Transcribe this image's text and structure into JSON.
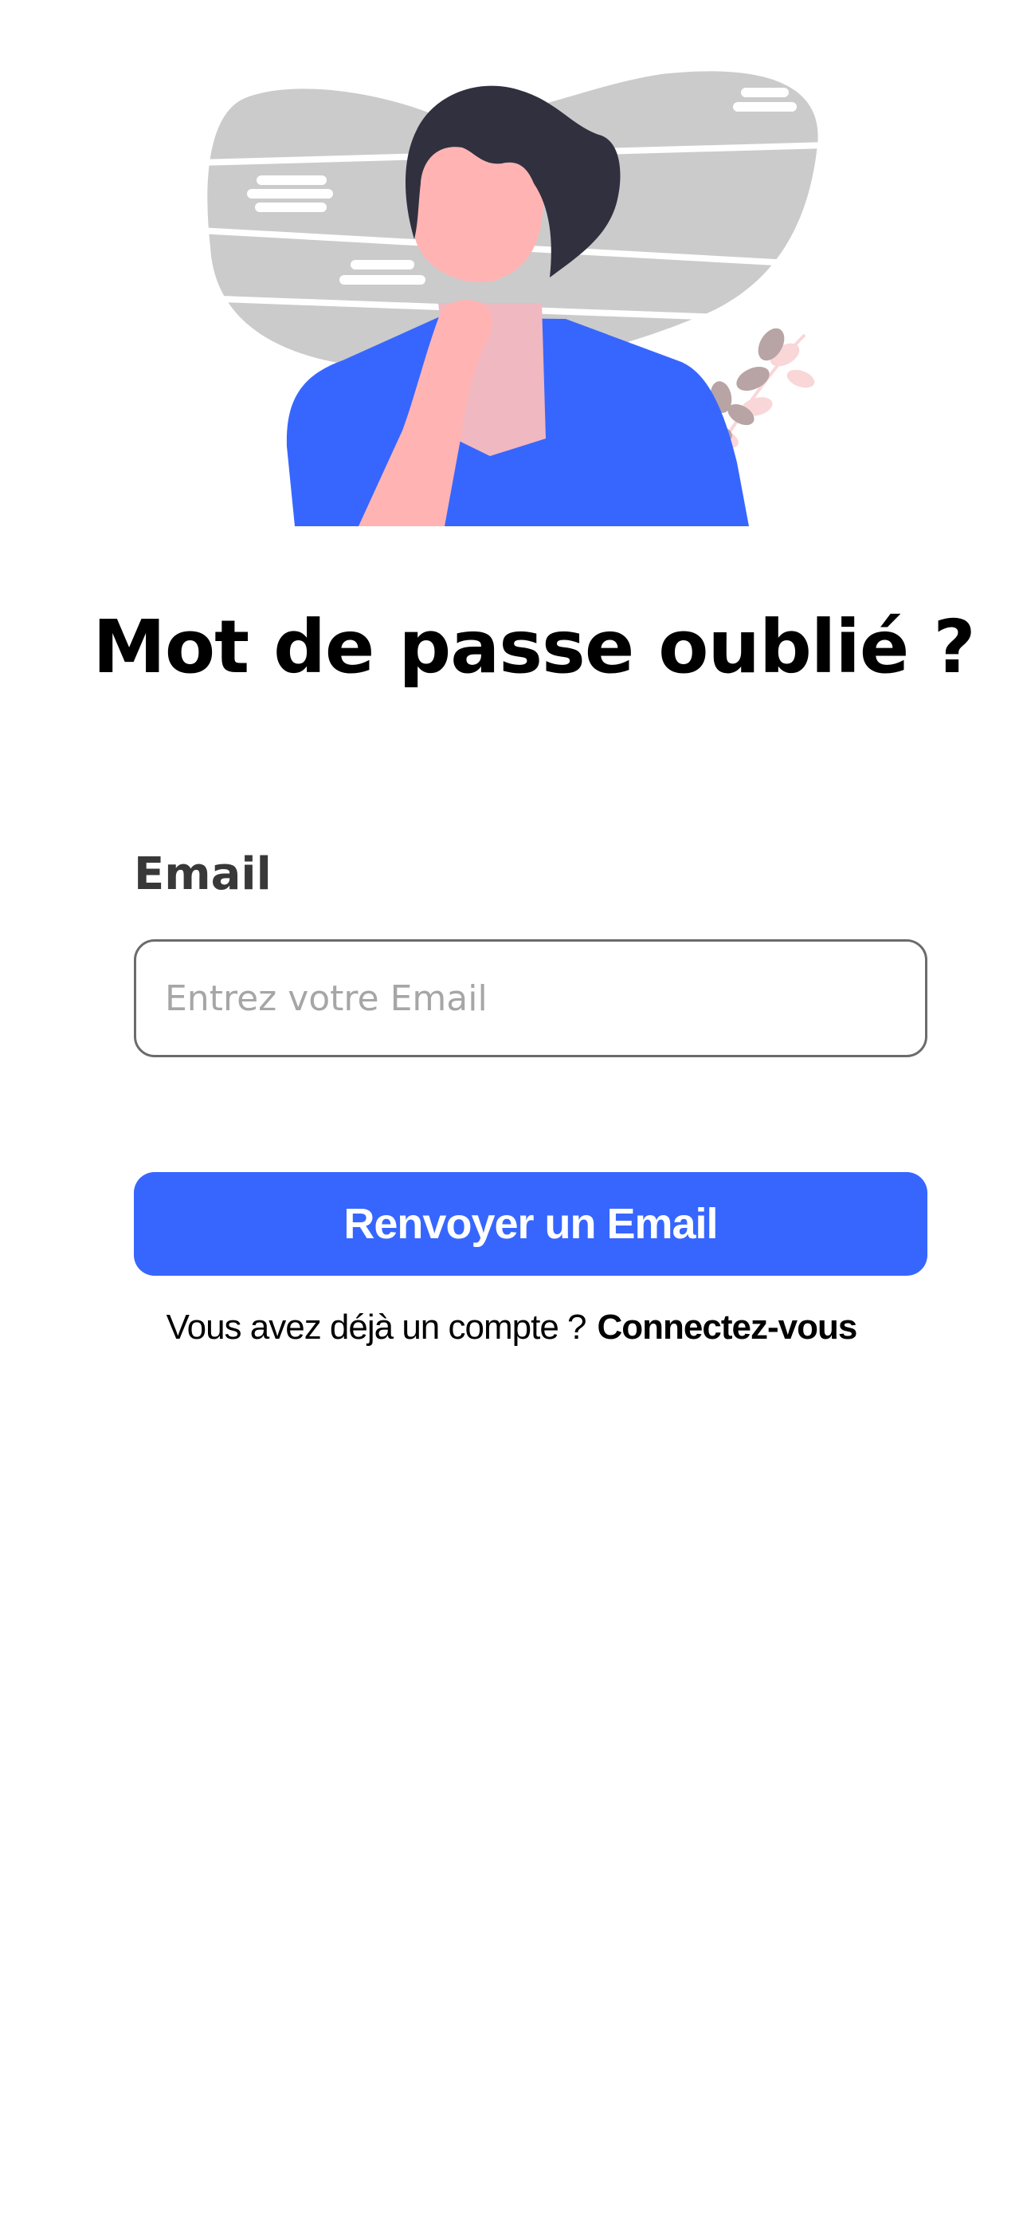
{
  "illustration": {
    "name": "person-thinking-illustration",
    "colors": {
      "backdrop": "#cbcbcb",
      "hair": "#31303f",
      "skin": "#ffb4b3",
      "shirt": "#3766ff",
      "neck": "#f0b8c0",
      "leaves_dark": "#b8a4a4",
      "leaves_light": "#f9d6d8"
    }
  },
  "page": {
    "title": "Mot de passe oublié ?"
  },
  "form": {
    "email_label": "Email",
    "email_placeholder": "Entrez votre Email",
    "email_value": "",
    "submit_label": "Renvoyer un Email"
  },
  "footer": {
    "question": "Vous avez déjà un compte ?",
    "login_link": "Connectez-vous"
  },
  "colors": {
    "accent": "#3766ff",
    "input_border": "#6b6b6b",
    "placeholder": "#a6a6a6",
    "label": "#383838"
  }
}
